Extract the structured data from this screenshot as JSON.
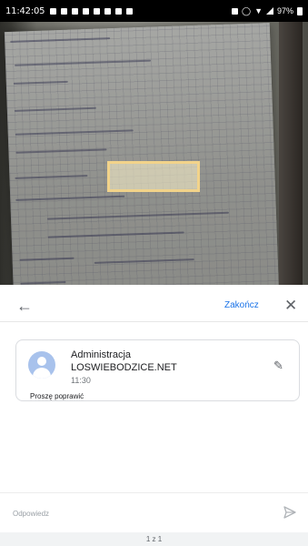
{
  "status_bar": {
    "time": "11:42:05",
    "battery": "97%"
  },
  "toolbar": {
    "back_icon": "arrow-left-icon",
    "finish_label": "Zakończ",
    "close_icon": "close-icon"
  },
  "comment": {
    "author_line1": "Administracja",
    "author_line2": "LOSWIEBODZICE.NET",
    "time": "11:30",
    "text": "Proszę poprawić",
    "avatar_icon": "person-avatar-icon",
    "edit_icon": "pencil-icon"
  },
  "reply": {
    "placeholder": "Odpowiedz",
    "send_icon": "send-icon"
  },
  "pager": {
    "label": "1 z 1"
  },
  "colors": {
    "accent": "#1a73e8",
    "highlight": "#f2d38a"
  }
}
